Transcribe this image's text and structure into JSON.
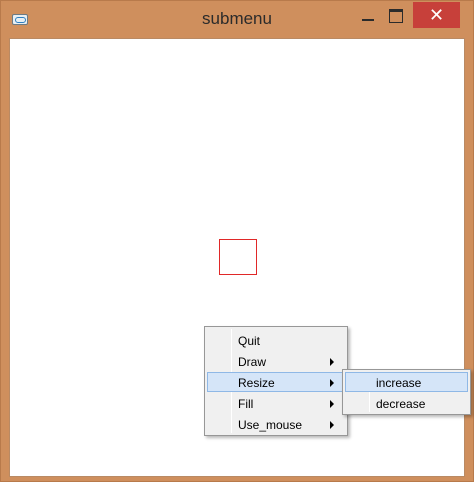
{
  "window": {
    "title": "submenu",
    "close_glyph": "✕"
  },
  "context_menu": {
    "items": [
      {
        "label": "Quit",
        "has_submenu": false
      },
      {
        "label": "Draw",
        "has_submenu": true
      },
      {
        "label": "Resize",
        "has_submenu": true,
        "highlighted": true
      },
      {
        "label": "Fill",
        "has_submenu": true
      },
      {
        "label": "Use_mouse",
        "has_submenu": true
      }
    ]
  },
  "submenu": {
    "parent": "Resize",
    "items": [
      {
        "label": "increase",
        "highlighted": true
      },
      {
        "label": "decrease"
      }
    ]
  },
  "icons": [
    "app-icon",
    "minimize-icon",
    "maximize-icon",
    "close-icon",
    "submenu-arrow-icon"
  ],
  "colors": {
    "frame": "#cf8f5d",
    "close_button": "#c7403a",
    "square_outline": "#e02828",
    "menu_highlight": "#d5e5f8"
  }
}
